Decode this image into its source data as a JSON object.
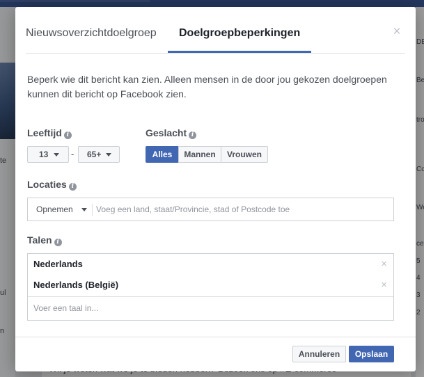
{
  "background": {
    "left_snippets": [
      "te",
      "ul",
      "n"
    ],
    "right_snippets": [
      "DE",
      "Be",
      "tro",
      "Co",
      "We",
      "ce",
      "5",
      "4",
      "3",
      "2"
    ],
    "bottom_text": "Wil je weten wat we je te bieden hebben? Bezoek ons op #E-commerce"
  },
  "dialog": {
    "tabs": [
      {
        "label": "Nieuwsoverzichtdoelgroep",
        "active": false
      },
      {
        "label": "Doelgroepbeperkingen",
        "active": true
      }
    ],
    "close_glyph": "×",
    "description": "Beperk wie dit bericht kan zien. Alleen mensen in de door jou gekozen doelgroepen kunnen dit bericht op Facebook zien.",
    "age": {
      "label": "Leeftijd",
      "min": "13",
      "max": "65+",
      "separator": "-"
    },
    "gender": {
      "label": "Geslacht",
      "options": [
        "Alles",
        "Mannen",
        "Vrouwen"
      ],
      "selected": "Alles"
    },
    "locations": {
      "label": "Locaties",
      "mode": "Opnemen",
      "placeholder": "Voeg een land, staat/Provincie, stad of Postcode toe"
    },
    "languages": {
      "label": "Talen",
      "selected": [
        "Nederlands",
        "Nederlands (België)"
      ],
      "remove_glyph": "×",
      "placeholder": "Voer een taal in..."
    },
    "buttons": {
      "cancel": "Annuleren",
      "save": "Opslaan"
    },
    "info_glyph": "i"
  },
  "colors": {
    "accent": "#4267b2",
    "header_bar": "#3b5998"
  }
}
